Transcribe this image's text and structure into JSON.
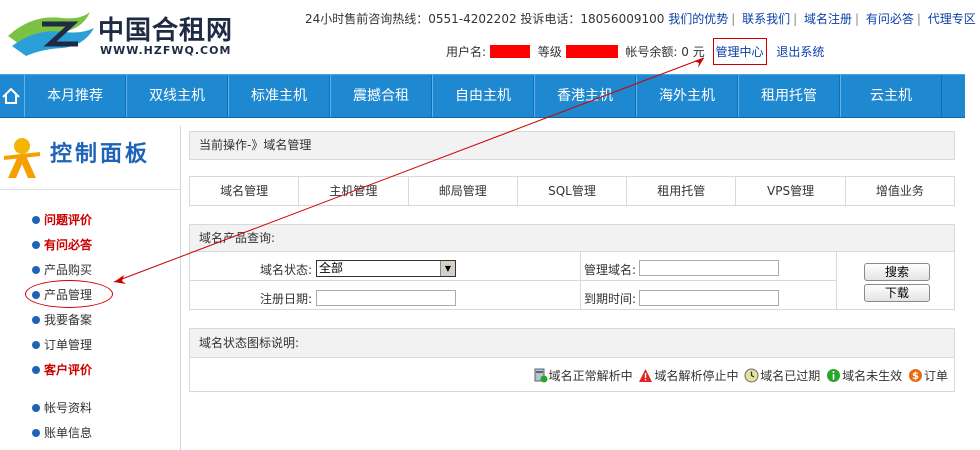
{
  "header": {
    "logo_text": "中国合租网",
    "logo_url": "WWW.HZFWQ.COM",
    "hotline_text": "24小时售前咨询热线：0551-4202202 投诉电话：18056009100",
    "links": [
      "我们的优势",
      "联系我们",
      "域名注册",
      "有问必答",
      "代理专区"
    ],
    "user_label": "用户名:",
    "level_label": "等级",
    "balance_label": "帐号余额:",
    "balance_value": "0 元",
    "mgmt_center": "管理中心",
    "logout": "退出系统"
  },
  "nav": {
    "items": [
      "本月推荐",
      "双线主机",
      "标准主机",
      "震撼合租",
      "自由主机",
      "香港主机",
      "海外主机",
      "租用托管",
      "云主机"
    ]
  },
  "sidebar": {
    "title": "控制面板",
    "items": [
      {
        "label": "问题评价",
        "style": "red"
      },
      {
        "label": "有问必答",
        "style": "red"
      },
      {
        "label": "产品购买",
        "style": "normal"
      },
      {
        "label": "产品管理",
        "style": "normal"
      },
      {
        "label": "我要备案",
        "style": "normal"
      },
      {
        "label": "订单管理",
        "style": "normal"
      },
      {
        "label": "客户评价",
        "style": "red"
      },
      {
        "label": "帐号资料",
        "style": "normal"
      },
      {
        "label": "账单信息",
        "style": "normal"
      }
    ]
  },
  "main": {
    "crumb": "当前操作-》域名管理",
    "tabs": [
      "域名管理",
      "主机管理",
      "邮局管理",
      "SQL管理",
      "租用托管",
      "VPS管理",
      "增值业务"
    ],
    "query": {
      "title": "域名产品查询:",
      "status_label": "域名状态:",
      "status_selected": "全部",
      "domain_label": "管理域名:",
      "regdate_label": "注册日期:",
      "expire_label": "到期时间:",
      "search_button": "搜索",
      "download_button": "下载"
    },
    "legend": {
      "title": "域名状态图标说明:",
      "items": [
        "域名正常解析中",
        "域名解析停止中",
        "域名已过期",
        "域名未生效",
        "订单"
      ]
    }
  },
  "colors": {
    "nav_bg": "#1e88d0",
    "link": "#0b3ea8",
    "accent_red": "#cc0000",
    "panel_title": "#1f63b7"
  }
}
